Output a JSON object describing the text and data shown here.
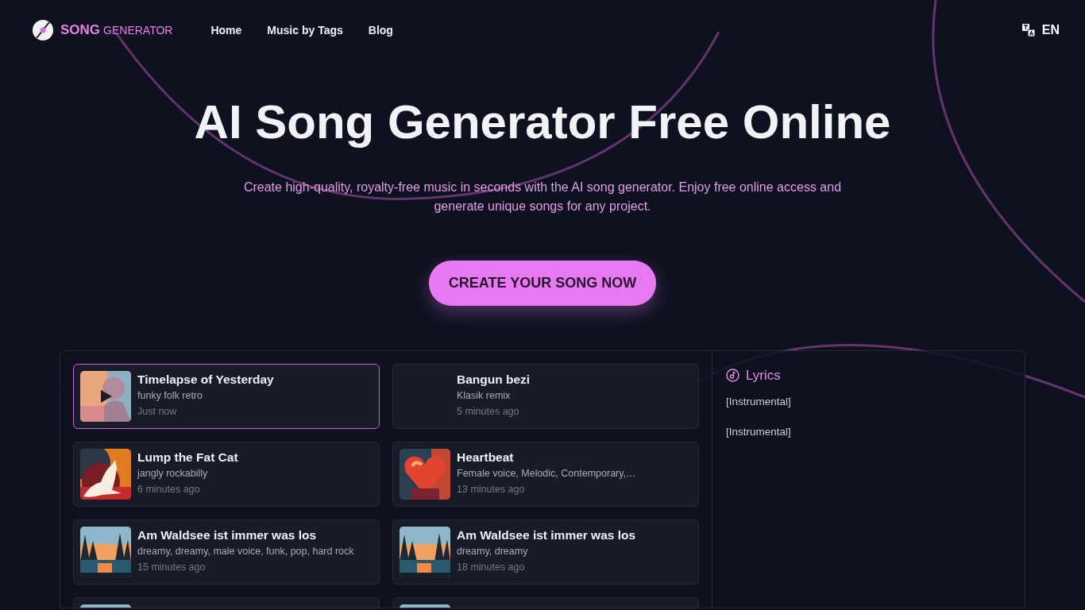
{
  "brand": {
    "strong": "SONG",
    "light": "GENERATOR"
  },
  "nav": [
    {
      "label": "Home"
    },
    {
      "label": "Music by Tags"
    },
    {
      "label": "Blog"
    }
  ],
  "language": "EN",
  "hero": {
    "title": "AI Song Generator Free Online",
    "subtitle": "Create high-quality, royalty-free music in seconds with the AI song generator. Enjoy free online access and generate unique songs for any project.",
    "cta": "CREATE YOUR SONG NOW"
  },
  "songs": [
    {
      "title": "Timelapse of Yesterday",
      "tags": "funky folk retro",
      "time": "Just now",
      "selected": true,
      "cover": true
    },
    {
      "title": "Bangun bezi",
      "tags": "Klasik remix",
      "time": "5 minutes ago",
      "selected": false,
      "cover": false
    },
    {
      "title": "Lump the Fat Cat",
      "tags": "jangly rockabilly",
      "time": "6 minutes ago",
      "selected": false,
      "cover": true
    },
    {
      "title": "Heartbeat",
      "tags": "Female voice, Melodic, Contemporary,…",
      "time": "13 minutes ago",
      "selected": false,
      "cover": true
    },
    {
      "title": "Am Waldsee ist immer was los",
      "tags": "dreamy, dreamy, male voice, funk, pop, hard rock",
      "time": "15 minutes ago",
      "selected": false,
      "cover": true
    },
    {
      "title": "Am Waldsee ist immer was los",
      "tags": "dreamy, dreamy",
      "time": "18 minutes ago",
      "selected": false,
      "cover": true
    },
    {
      "selected": false,
      "cover": true
    },
    {
      "selected": false,
      "cover": true
    }
  ],
  "lyrics": {
    "heading": "Lyrics",
    "lines": [
      "[Instrumental]",
      "[Instrumental]"
    ]
  }
}
